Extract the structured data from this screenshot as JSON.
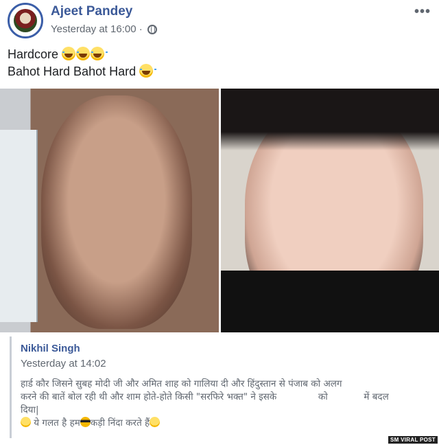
{
  "post": {
    "author": "Ajeet Pandey",
    "timestamp": "Yesterday at 16:00 ·",
    "privacy_icon": "globe-icon",
    "more_label": "•••",
    "text_line1": "Hardcore",
    "text_line2": "Bahot Hard Bahot Hard"
  },
  "comment": {
    "author": "Nikhil Singh",
    "timestamp": "Yesterday at 14:02",
    "line1": "हार्ड कौर जिसने सुबह मोदी जी और अमित शाह को गालिया दी और हिंदुस्तान से पंजाब को अलग",
    "line2a": "करने की बातें बोल रही थी और शाम होते-होते किसी \"सरफिरे भक्त\" ने इसके",
    "line2b": "को",
    "line2c": "में बदल",
    "line3": "दिया|",
    "line4a": "ये गलत है हम",
    "line4b": "कड़ी निंदा करते हैं"
  },
  "watermark": "SM VIRAL POST",
  "colors": {
    "name": "#3b5998",
    "meta": "#606770",
    "text": "#1c1e21"
  }
}
